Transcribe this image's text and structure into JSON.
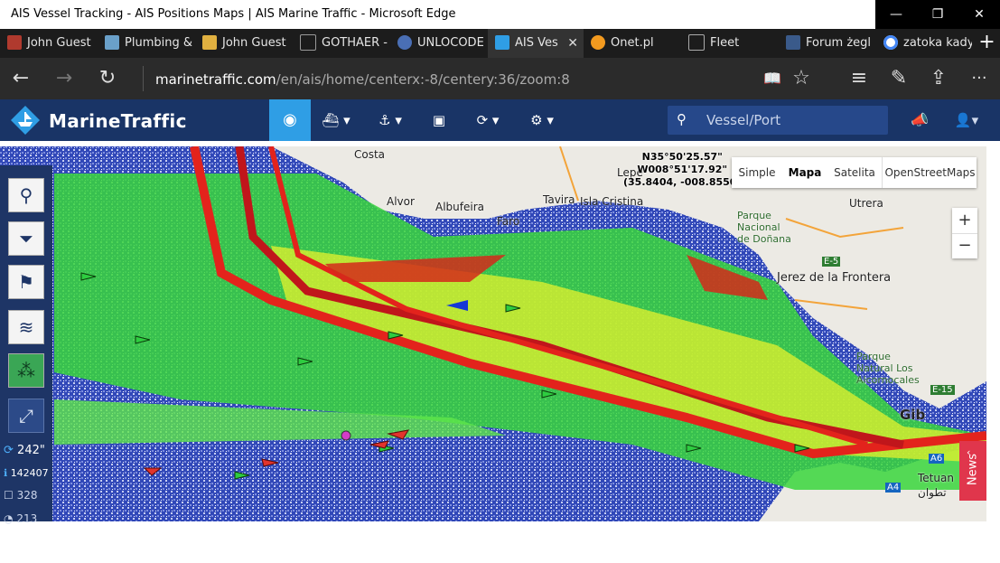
{
  "window": {
    "title": "AIS Vessel Tracking - AIS Positions Maps | AIS Marine Traffic - Microsoft Edge",
    "minimize": "—",
    "restore": "❐",
    "close": "✕"
  },
  "tabs": [
    {
      "label": "John Guest",
      "icon_color": "#b03a2e"
    },
    {
      "label": "Plumbing &",
      "icon_color": "#6aa0c9"
    },
    {
      "label": "John Guest",
      "icon_color": "#e0b040"
    },
    {
      "label": "GOTHAER -",
      "icon_color": "#999999"
    },
    {
      "label": "UNLOCODE",
      "icon_color": "#4a6fb5"
    },
    {
      "label": "AIS Ves",
      "icon_color": "#2f9ee5",
      "active": true
    },
    {
      "label": "Onet.pl",
      "icon_color": "#f29a1f"
    },
    {
      "label": "Fleet",
      "icon_color": "#aaaaaa"
    },
    {
      "label": "Forum żegl",
      "icon_color": "#3a5a8a"
    },
    {
      "label": "zatoka kady",
      "icon_color": "#4285f4"
    }
  ],
  "tab_close": "✕",
  "new_tab": "+",
  "nav": {
    "back": "←",
    "forward": "→",
    "refresh": "↻",
    "url_host": "marinetraffic.com",
    "url_path": "/en/ais/home/centerx:-8/centery:36/zoom:8",
    "reading": "📖",
    "favorite": "☆",
    "hub": "≡",
    "note": "✎",
    "share": "⇪",
    "more": "···"
  },
  "site": {
    "brand": "MarineTraffic",
    "search_placeholder": "Vessel/Port",
    "header_colors": {
      "bar": "#193466",
      "active": "#2f9ee5"
    }
  },
  "map": {
    "coord_line1": "N35°50'25.57\"",
    "coord_line2": "W008°51'17.92\"",
    "coord_line3": "(35.8404, -008.8550)",
    "map_types": [
      "Simple",
      "Mapa",
      "Satelita",
      "OpenStreetMaps"
    ],
    "selected_map_type": "Mapa",
    "zoom_in": "+",
    "zoom_out": "−",
    "news": "News",
    "places": [
      "Costa",
      "Alvor",
      "Albufeira",
      "Faro",
      "Tavira",
      "Isla Cristina",
      "Lepe",
      "Utrera",
      "Parque Nacional de Doñana",
      "Jerez de la Frontera",
      "Parque Natural Los Alcornocales",
      "Gib",
      "Tetuan",
      "تطوان",
      "E-5",
      "E-15",
      "A4",
      "A6"
    ]
  },
  "left_panel": {
    "stats": [
      {
        "icon": "⟳",
        "value": "242\""
      },
      {
        "icon": "ℹ",
        "value": "142407"
      },
      {
        "icon": "☐",
        "value": "328"
      },
      {
        "icon": "◔",
        "value": "213"
      }
    ]
  }
}
